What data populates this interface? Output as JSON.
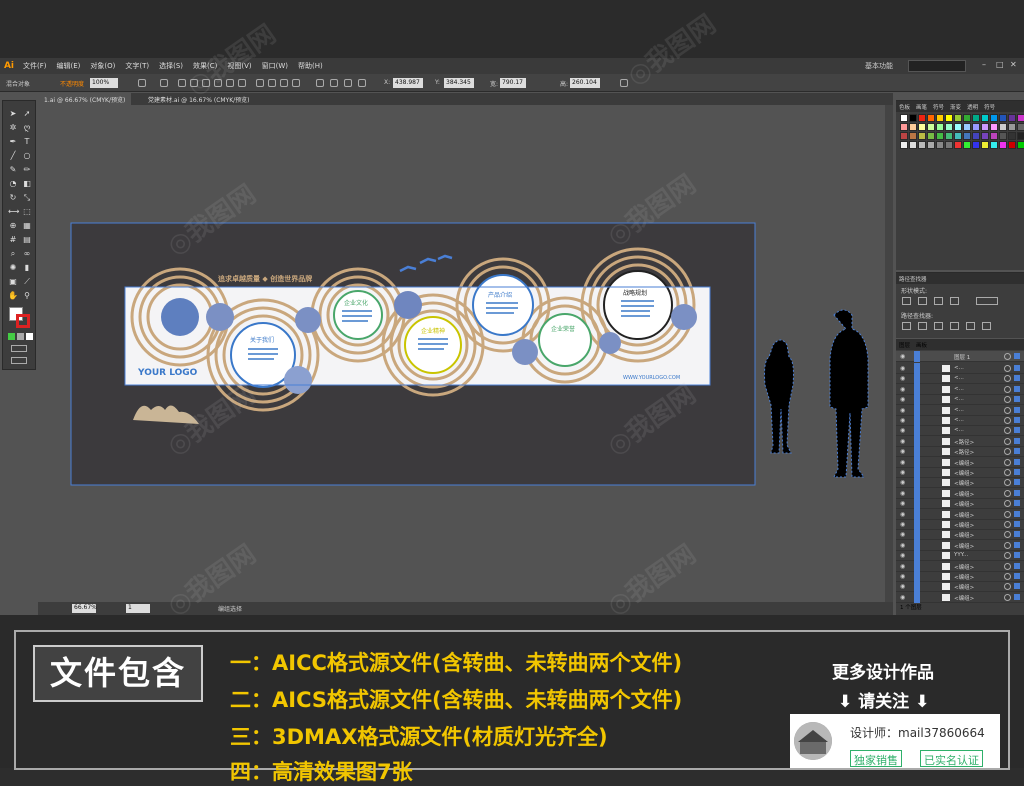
{
  "app": {
    "logo": "Ai"
  },
  "menu": [
    "文件(F)",
    "编辑(E)",
    "对象(O)",
    "文字(T)",
    "选择(S)",
    "效果(C)",
    "视图(V)",
    "窗口(W)",
    "帮助(H)"
  ],
  "workspace": "基本功能",
  "control": {
    "label": "混合对象",
    "opacity_label": "不透明度",
    "opacity": "100%",
    "x": "438.987",
    "y": "384.345",
    "w": "790.17",
    "h": "260.104"
  },
  "tabs": [
    "1.ai @ 66.67% (CMYK/预览)",
    "党建素材.ai @ 16.67% (CMYK/预览)"
  ],
  "status": {
    "zoom": "66.67%",
    "page": "1",
    "tool": "编组选择"
  },
  "panel_tabs": [
    "色板",
    "画笔",
    "符号",
    "渐变",
    "透明",
    "符号"
  ],
  "pathfinder": {
    "title": "路径查找器",
    "shape_modes": "形状模式:",
    "pathfinders": "路径查找器:"
  },
  "layers": {
    "tabs": [
      "图层",
      "画板"
    ],
    "top": "图层 1",
    "count": "1 个图层",
    "rows": [
      "<...",
      "<...",
      "<...",
      "<...",
      "<...",
      "<...",
      "<...",
      "<路径>",
      "<路径>",
      "<编组>",
      "<编组>",
      "<编组>",
      "<编组>",
      "<编组>",
      "<编组>",
      "<编组>",
      "<编组>",
      "<编组>",
      "YYY...",
      "<编组>",
      "<编组>",
      "<编组>",
      "<编组>"
    ]
  },
  "artwork": {
    "slogan": "追求卓越质量 ◆ 创造世界品牌",
    "logo": "YOUR LOGO",
    "logo_url": "WWW.YOURLOGO.COM",
    "sections": [
      "关于我们",
      "企业文化",
      "企业精神",
      "产品介绍",
      "企业荣誉",
      "战略规划"
    ]
  },
  "banner": {
    "box": "文件包含",
    "lines": [
      "一：AICC格式源文件(含转曲、未转曲两个文件)",
      "二：AICS格式源文件(含转曲、未转曲两个文件)",
      "三：3DMAX格式源文件(材质灯光齐全)",
      "四：高清效果图7张"
    ],
    "more": "更多设计作品",
    "follow": "⬇ 请关注 ⬇",
    "designer": "设计师：mail37860664",
    "badge1": "独家销售",
    "badge2": "已实名认证"
  },
  "colors": {
    "accent": "#f2c600",
    "selection": "#4a7fd6",
    "artboard_bg": "#3c3a3d",
    "ring": "#c9a77d"
  }
}
